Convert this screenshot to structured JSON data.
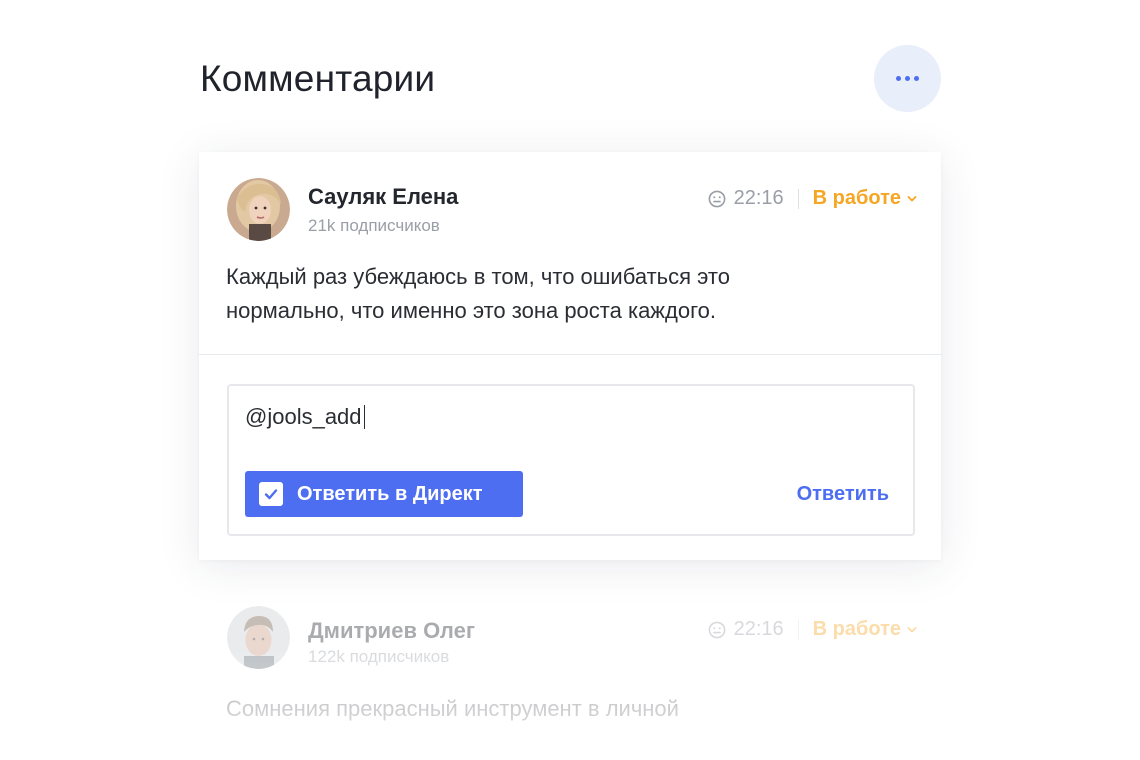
{
  "header": {
    "title": "Комментарии",
    "more_icon": "more-dots-icon"
  },
  "colors": {
    "accent": "#4e6ef2",
    "status": "#f5a623",
    "muted": "#9a9ea6"
  },
  "comments": [
    {
      "author": "Сауляк Елена",
      "followers": "21k подписчиков",
      "time": "22:16",
      "status": "В работе",
      "text_lines": [
        "Каждый раз убеждаюсь в том, что ошибаться это",
        "нормально, что именно это зона роста каждого."
      ]
    },
    {
      "author": "Дмитриев Олег",
      "followers": "122k подписчиков",
      "time": "22:16",
      "status": "В работе",
      "text_lines": [
        "Сомнения прекрасный инструмент в личной"
      ]
    }
  ],
  "reply": {
    "value": "@jools_add",
    "direct_label": "Ответить в Директ",
    "direct_checked": true,
    "submit_label": "Ответить"
  }
}
